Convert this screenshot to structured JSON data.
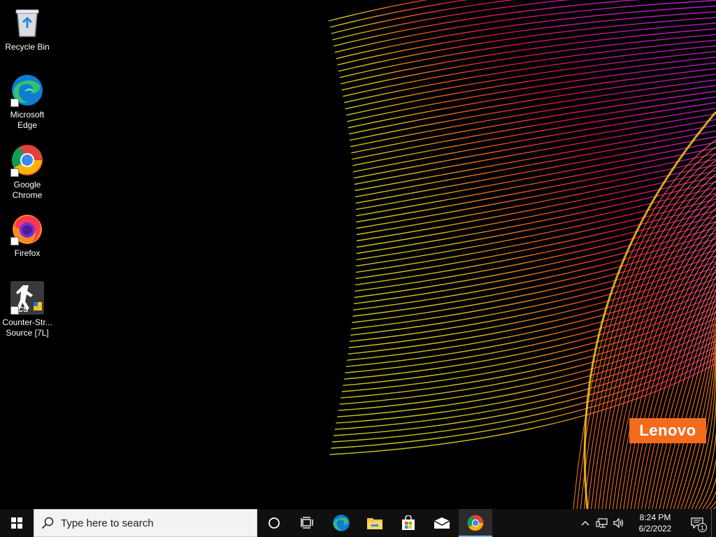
{
  "desktop": {
    "icons": [
      {
        "label": "Recycle Bin",
        "icon": "recycle-bin-icon"
      },
      {
        "label": "Microsoft\nEdge",
        "icon": "edge-icon"
      },
      {
        "label": "Google\nChrome",
        "icon": "chrome-icon"
      },
      {
        "label": "Firefox",
        "icon": "firefox-icon"
      },
      {
        "label": "Counter-Str...\nSource [7L]",
        "icon": "counter-strike-icon"
      }
    ],
    "brand_logo": "Lenovo",
    "brand_color": "#f36b1c"
  },
  "taskbar": {
    "search_placeholder": "Type here to search",
    "pinned": [
      "start-icon",
      "cortana-icon",
      "task-view-icon",
      "edge-icon",
      "file-explorer-icon",
      "store-icon",
      "mail-icon",
      "chrome-icon"
    ],
    "active_app": "chrome-icon",
    "clock": {
      "time": "8:24 PM",
      "date": "6/2/2022"
    },
    "notification_count": "1"
  }
}
